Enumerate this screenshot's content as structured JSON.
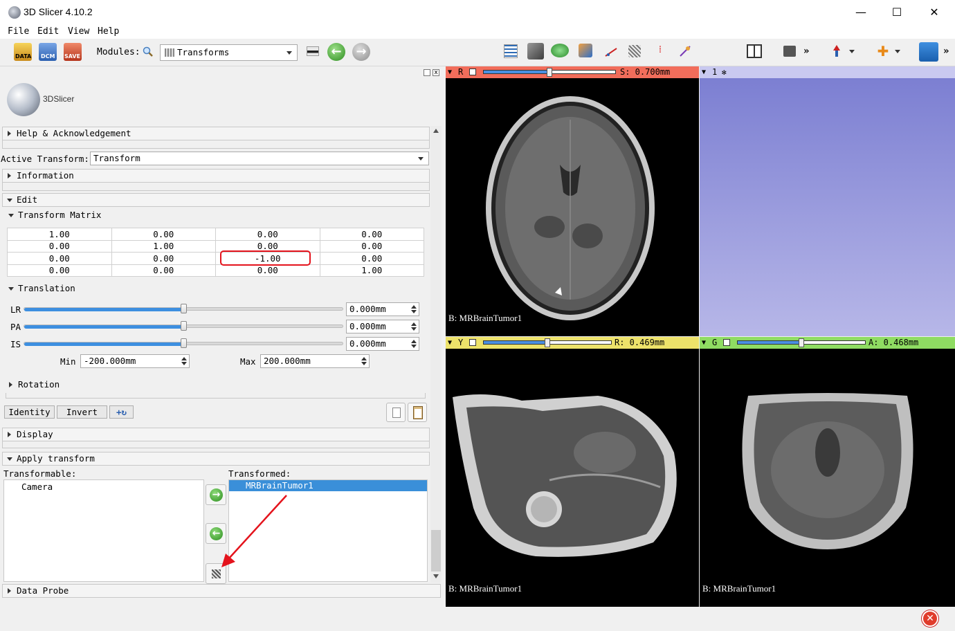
{
  "window": {
    "title": "3D Slicer 4.10.2",
    "minimize": "—",
    "maximize": "☐",
    "close": "✕"
  },
  "menu": [
    "File",
    "Edit",
    "View",
    "Help"
  ],
  "toolbar": {
    "data_label": "DATA",
    "dcm_label": "DCM",
    "save_label": "SAVE",
    "modules_label": "Modules:",
    "module_selected": "Transforms",
    "more_label": "»"
  },
  "logo": {
    "text": "3DSlicer"
  },
  "sections": {
    "help": "Help & Acknowledgement",
    "active_transform_label": "Active Transform:",
    "active_transform_value": "Transform",
    "information": "Information",
    "edit": "Edit",
    "transform_matrix": "Transform Matrix",
    "translation": "Translation",
    "rotation": "Rotation",
    "display": "Display",
    "apply_transform": "Apply transform",
    "data_probe": "Data Probe"
  },
  "matrix": [
    [
      "1.00",
      "0.00",
      "0.00",
      "0.00"
    ],
    [
      "0.00",
      "1.00",
      "0.00",
      "0.00"
    ],
    [
      "0.00",
      "0.00",
      "-1.00",
      "0.00"
    ],
    [
      "0.00",
      "0.00",
      "0.00",
      "1.00"
    ]
  ],
  "translation": {
    "lr_label": "LR",
    "lr_value": "0.000mm",
    "lr_fraction": 0.5,
    "pa_label": "PA",
    "pa_value": "0.000mm",
    "pa_fraction": 0.5,
    "is_label": "IS",
    "is_value": "0.000mm",
    "is_fraction": 0.5,
    "min_label": "Min",
    "min_value": "-200.000mm",
    "max_label": "Max",
    "max_value": "200.000mm"
  },
  "buttons": {
    "identity": "Identity",
    "invert": "Invert"
  },
  "apply": {
    "transformable_label": "Transformable:",
    "transformable_items": [
      "Camera"
    ],
    "transformed_label": "Transformed:",
    "transformed_items": [
      "MRBrainTumor1"
    ]
  },
  "views": {
    "red": {
      "letter": "R",
      "value": "S: 0.700mm",
      "caption": "B: MRBrainTumor1",
      "color": "#f26d5b",
      "slider_fraction": 0.5
    },
    "threed": {
      "letter": "1"
    },
    "yellow": {
      "letter": "Y",
      "value": "R: 0.469mm",
      "caption": "B: MRBrainTumor1",
      "color": "#ede26a",
      "slider_fraction": 0.5
    },
    "green": {
      "letter": "G",
      "value": "A: 0.468mm",
      "caption": "B: MRBrainTumor1",
      "color": "#8fdc62",
      "slider_fraction": 0.5
    }
  },
  "colors": {
    "highlight": "#e4131c",
    "selection": "#3a8fd9",
    "threed_bg_top": "#7c7fd2",
    "threed_bg_bottom": "#b7b7e8"
  }
}
